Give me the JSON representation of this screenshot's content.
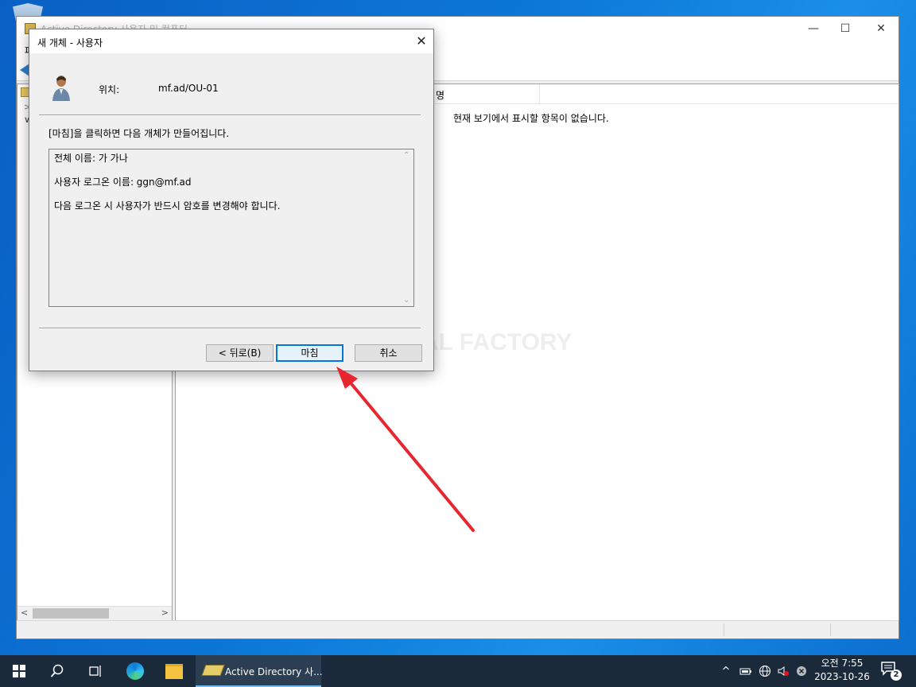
{
  "mmc": {
    "title": "Active Directory 사용자 및 컴퓨터",
    "menu_file": "파",
    "list_column_name": "명",
    "list_empty_text": "현재 보기에서 표시할 항목이 없습니다.",
    "minimize": "—",
    "maximize": "☐",
    "close": "✕"
  },
  "watermark": "MANUAL FACTORY",
  "dialog": {
    "title": "새 개체 - 사용자",
    "close": "✕",
    "location_label": "위치:",
    "location_value": "mf.ad/OU-01",
    "instruction": "[마침]을 클릭하면 다음 개체가 만들어집니다.",
    "summary_lines": [
      "전체 이름: 가 가나",
      "사용자 로그온 이름: ggn@mf.ad",
      "다음 로그온 시 사용자가 반드시 암호를 변경해야 합니다."
    ],
    "buttons": {
      "back": "< 뒤로(B)",
      "finish": "마침",
      "cancel": "취소"
    }
  },
  "taskbar": {
    "active_task_label": "Active Directory 사...",
    "clock_time": "오전 7:55",
    "clock_date": "2023-10-26",
    "notification_count": "2",
    "tray_chevron": "^"
  },
  "colors": {
    "accent": "#0078d7",
    "arrow": "#e8262f",
    "taskbar": "#1a2a3b"
  }
}
